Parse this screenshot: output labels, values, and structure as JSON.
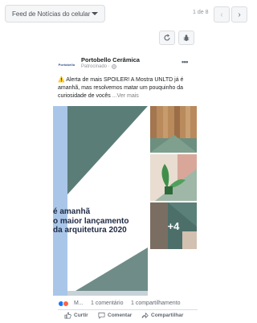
{
  "toolbar": {
    "placement_label": "Feed de Notícias do celular",
    "pager_text": "1 de 8"
  },
  "post": {
    "avatar_text": "Portobello",
    "page_name": "Portobello Cerâmica",
    "sponsored": "Patrocinado · ",
    "text_warn": "⚠️",
    "text_body": " Alerta de mais SPOILER! A Mostra UNLTD já é amanhã, mas resolvemos matar um pouquinho da curiosidade de vocês",
    "see_more": " ...Ver mais",
    "headline_lines": [
      "é amanhã",
      "o maior lançamento",
      "da arquitetura 2020"
    ],
    "extra_images": "+4",
    "reaction_names": "M...",
    "comments_count": "1 comentário",
    "shares_count": "1 compartilhamento",
    "actions": {
      "like": "Curtir",
      "comment": "Comentar",
      "share": "Compartilhar"
    }
  },
  "colors": {
    "brand_blue": "#1877f2",
    "teal": "#5b7d78",
    "light_blue": "#a9c6e8"
  }
}
